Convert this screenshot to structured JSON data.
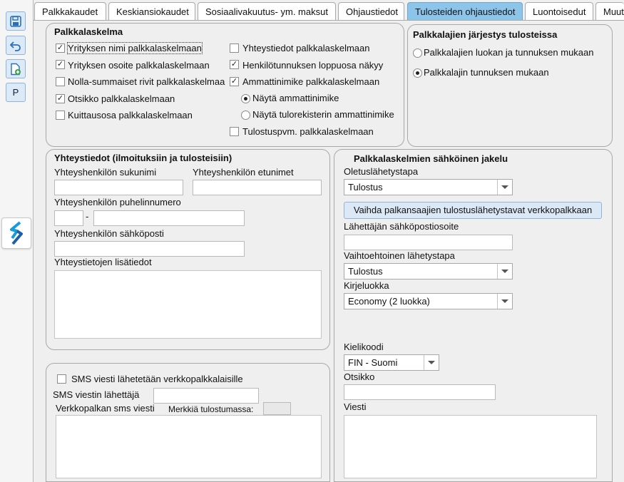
{
  "tabs": [
    {
      "label": "Palkkakaudet"
    },
    {
      "label": "Keskiansiokaudet"
    },
    {
      "label": "Sosiaalivakuutus- ym. maksut"
    },
    {
      "label": "Ohjaustiedot"
    },
    {
      "label": "Tulosteiden ohjaustiedot"
    },
    {
      "label": "Luontoisedut"
    },
    {
      "label": "Muut"
    }
  ],
  "active_tab_index": 4,
  "toolbar": {
    "p_label": "P"
  },
  "palkkalaskelma": {
    "title": "Palkkalaskelma",
    "left_checks": [
      {
        "label": "Yrityksen nimi palkkalaskelmaan",
        "checked": true
      },
      {
        "label": "Yrityksen osoite palkkalaskelmaan",
        "checked": true
      },
      {
        "label": "Nolla-summaiset rivit palkkalaskelmaa",
        "checked": false
      },
      {
        "label": "Otsikko palkkalaskelmaan",
        "checked": true
      },
      {
        "label": "Kuittausosa palkkalaskelmaan",
        "checked": false
      }
    ],
    "right_checks": [
      {
        "label": "Yhteystiedot palkkalaskelmaan",
        "checked": false
      },
      {
        "label": "Henkilötunnuksen loppuosa näkyy",
        "checked": true
      },
      {
        "label": "Ammattinimike palkkalaskelmaan",
        "checked": true
      }
    ],
    "radios": [
      {
        "label": "Näytä ammattinimike",
        "selected": true
      },
      {
        "label": "Näytä tulorekisterin ammattinimike",
        "selected": false
      }
    ],
    "print_date": {
      "label": "Tulostuspvm. palkkalaskelmaan",
      "checked": false
    }
  },
  "jarjestys": {
    "title": "Palkkalajien järjestys tulosteissa",
    "options": [
      {
        "label": "Palkkalajien luokan ja tunnuksen mukaan",
        "selected": false
      },
      {
        "label": "Palkkalajin tunnuksen mukaan",
        "selected": true
      }
    ]
  },
  "yhteystiedot": {
    "title": "Yhteystiedot (ilmoituksiin ja tulosteisiin)",
    "surname_label": "Yhteyshenkilön sukunimi",
    "firstname_label": "Yhteyshenkilön etunimet",
    "phone_label": "Yhteyshenkilön puhelinnumero",
    "phone_sep": "-",
    "email_label": "Yhteyshenkilön sähköposti",
    "extra_label": "Yhteystietojen lisätiedot"
  },
  "sms": {
    "check_label": "SMS viesti lähetetään verkkopalkkalaisille",
    "checked": false,
    "sender_label": "SMS viestin lähettäjä",
    "message_label": "Verkkopalkan sms viesti",
    "chars_label": "Merkkiä tulostumassa:"
  },
  "jakelu": {
    "title": "Palkkalaskelmien sähköinen jakelu",
    "default_method_label": "Oletuslähetystapa",
    "default_method_value": "Tulostus",
    "change_button": "Vaihda palkansaajien tulostuslähetystavat verkkopalkkaan",
    "sender_email_label": "Lähettäjän sähköpostiosoite",
    "alt_method_label": "Vaihtoehtoinen lähetystapa",
    "alt_method_value": "Tulostus",
    "mail_class_label": "Kirjeluokka",
    "mail_class_value": "Economy (2 luokka)",
    "lang_label": "Kielikoodi",
    "lang_value": "FIN - Suomi",
    "subject_label": "Otsikko",
    "message_label": "Viesti"
  }
}
